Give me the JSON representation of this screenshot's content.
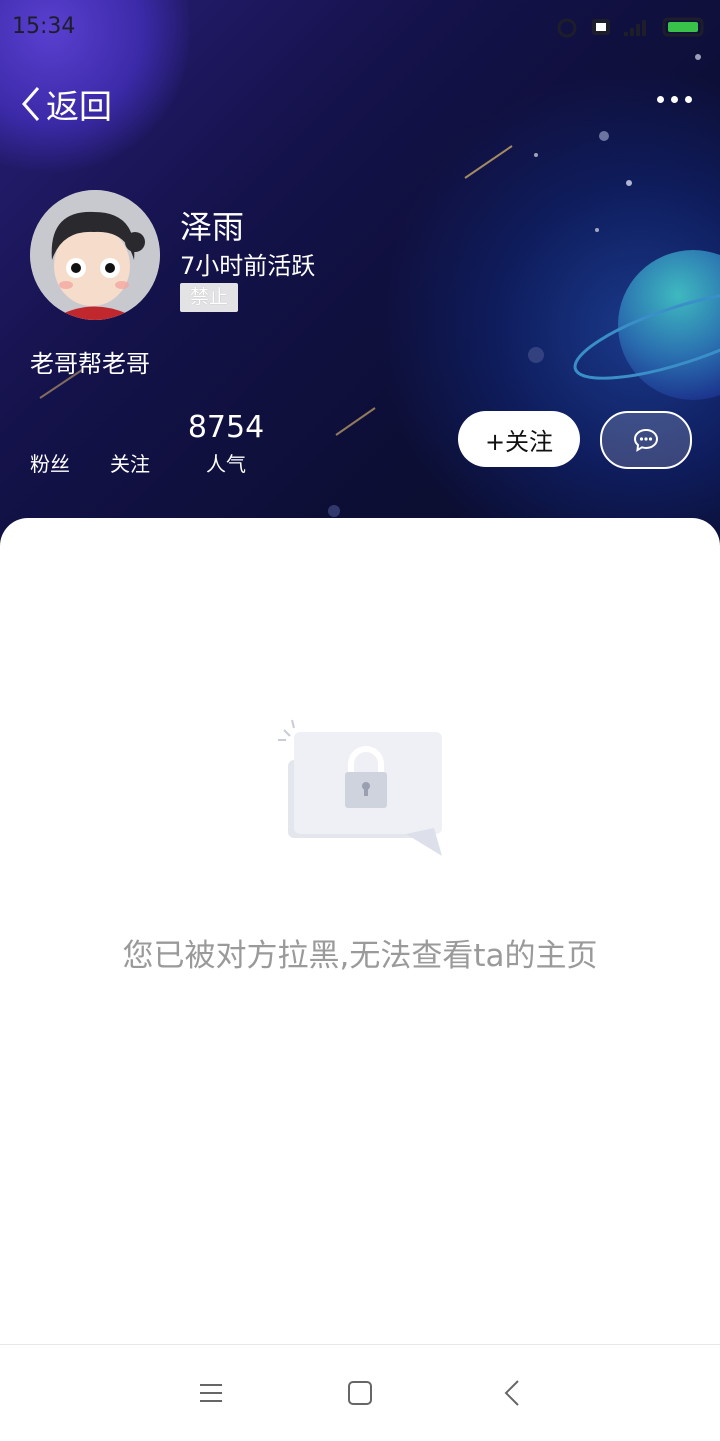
{
  "status_bar": {
    "time": "15:34"
  },
  "nav": {
    "back_label": "返回",
    "more_icon": "more-dots-icon"
  },
  "profile": {
    "name": "泽雨",
    "active_status": "7小时前活跃",
    "badge": "禁止",
    "bio": "老哥帮老哥"
  },
  "stats": {
    "fans": {
      "value": "",
      "label": "粉丝"
    },
    "following": {
      "value": "",
      "label": "关注"
    },
    "popularity": {
      "value": "8754",
      "label": "人气"
    }
  },
  "actions": {
    "follow_label": "+关注",
    "message_icon": "chat-bubble-icon"
  },
  "main": {
    "blocked_message": "您已被对方拉黑,无法查看ta的主页",
    "illustration_icon": "lock-icon"
  },
  "system_nav": {
    "menu_icon": "menu-icon",
    "home_icon": "home-icon",
    "back_icon": "back-icon"
  },
  "colors": {
    "header_dark": "#0c0e33",
    "header_purple": "#2a1f7a",
    "message_gray": "#9a9a9a",
    "badge_bg": "#e3e3e6"
  }
}
